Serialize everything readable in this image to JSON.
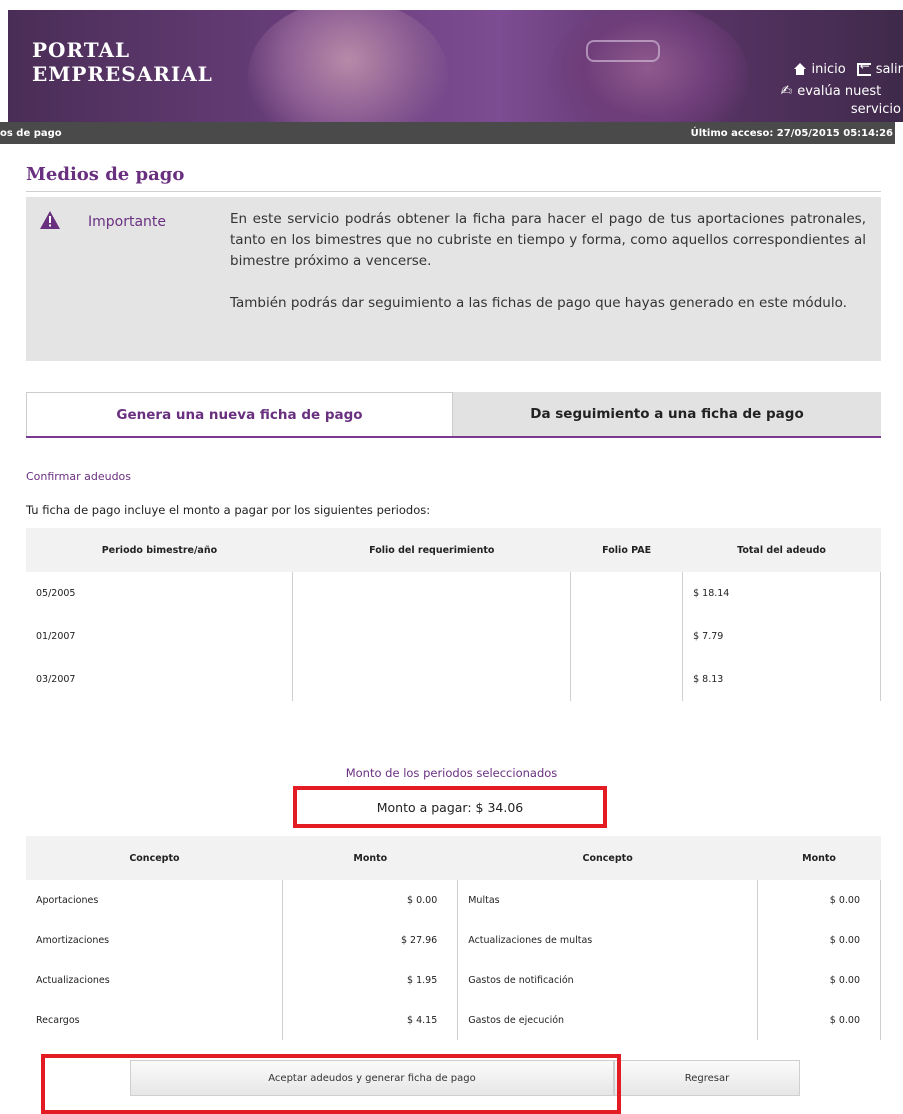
{
  "header": {
    "portal_line1": "PORTAL",
    "portal_line2": "EMPRESARIAL",
    "home_link": "inicio",
    "exit_link": "salir",
    "evaluate_link": "evalúa nuest",
    "evaluate_link_cont": "servicio",
    "breadcrumb": "os de pago",
    "last_access": "Último acceso: 27/05/2015 05:14:26"
  },
  "page": {
    "title": "Medios de pago"
  },
  "important": {
    "label": "Importante",
    "paragraph1": "En este servicio podrás obtener la ficha para hacer el pago de tus aportaciones patronales, tanto en los bimestres que no cubriste en tiempo y forma, como aquellos correspondientes al bimestre próximo a vencerse.",
    "paragraph2": "También podrás dar seguimiento a las fichas de pago que hayas generado en este módulo."
  },
  "tabs": [
    {
      "label": "Genera una nueva ficha de pago"
    },
    {
      "label": "Da seguimiento a una ficha de pago"
    }
  ],
  "confirm": {
    "section_link": "Confirmar adeudos",
    "intro": "Tu ficha de pago incluye el monto a pagar por los siguientes periodos:"
  },
  "periods_table": {
    "headers": [
      "Periodo bimestre/año",
      "Folio del requerimiento",
      "Folio PAE",
      "Total del adeudo"
    ],
    "rows": [
      [
        "05/2005",
        "",
        "",
        "$ 18.14"
      ],
      [
        "01/2007",
        "",
        "",
        "$ 7.79"
      ],
      [
        "03/2007",
        "",
        "",
        "$ 8.13"
      ]
    ]
  },
  "monto": {
    "title": "Monto de los periodos seleccionados",
    "total": "Monto a pagar: $ 34.06"
  },
  "concepts_table": {
    "headers": [
      "Concepto",
      "Monto",
      "Concepto",
      "Monto"
    ],
    "rows": [
      [
        "Aportaciones",
        "$ 0.00",
        "Multas",
        "$ 0.00"
      ],
      [
        "Amortizaciones",
        "$ 27.96",
        "Actualizaciones de multas",
        "$ 0.00"
      ],
      [
        "Actualizaciones",
        "$ 1.95",
        "Gastos de notificación",
        "$ 0.00"
      ],
      [
        "Recargos",
        "$ 4.15",
        "Gastos de ejecución",
        "$ 0.00"
      ]
    ]
  },
  "buttons": {
    "accept": "Aceptar adeudos y generar ficha de pago",
    "back": "Regresar"
  },
  "colors": {
    "brand_purple": "#6a3080",
    "highlight_red": "#e31b23"
  }
}
